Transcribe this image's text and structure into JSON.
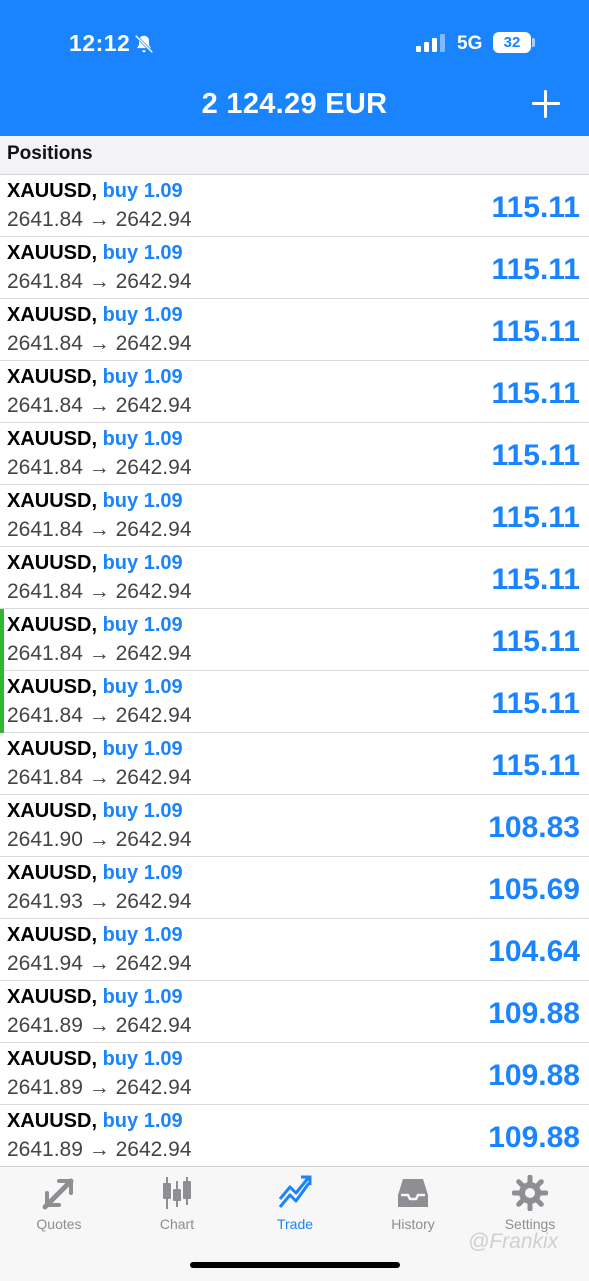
{
  "status_bar": {
    "time": "12:12",
    "network": "5G",
    "battery": "32"
  },
  "header": {
    "balance": "2 124.29 EUR"
  },
  "section": {
    "title": "Positions"
  },
  "positions": [
    {
      "symbol": "XAUUSD",
      "side": "buy 1.09",
      "open": "2641.84",
      "current": "2642.94",
      "profit": "115.11",
      "marked": false
    },
    {
      "symbol": "XAUUSD",
      "side": "buy 1.09",
      "open": "2641.84",
      "current": "2642.94",
      "profit": "115.11",
      "marked": false
    },
    {
      "symbol": "XAUUSD",
      "side": "buy 1.09",
      "open": "2641.84",
      "current": "2642.94",
      "profit": "115.11",
      "marked": false
    },
    {
      "symbol": "XAUUSD",
      "side": "buy 1.09",
      "open": "2641.84",
      "current": "2642.94",
      "profit": "115.11",
      "marked": false
    },
    {
      "symbol": "XAUUSD",
      "side": "buy 1.09",
      "open": "2641.84",
      "current": "2642.94",
      "profit": "115.11",
      "marked": false
    },
    {
      "symbol": "XAUUSD",
      "side": "buy 1.09",
      "open": "2641.84",
      "current": "2642.94",
      "profit": "115.11",
      "marked": false
    },
    {
      "symbol": "XAUUSD",
      "side": "buy 1.09",
      "open": "2641.84",
      "current": "2642.94",
      "profit": "115.11",
      "marked": false
    },
    {
      "symbol": "XAUUSD",
      "side": "buy 1.09",
      "open": "2641.84",
      "current": "2642.94",
      "profit": "115.11",
      "marked": true
    },
    {
      "symbol": "XAUUSD",
      "side": "buy 1.09",
      "open": "2641.84",
      "current": "2642.94",
      "profit": "115.11",
      "marked": true
    },
    {
      "symbol": "XAUUSD",
      "side": "buy 1.09",
      "open": "2641.84",
      "current": "2642.94",
      "profit": "115.11",
      "marked": false
    },
    {
      "symbol": "XAUUSD",
      "side": "buy 1.09",
      "open": "2641.90",
      "current": "2642.94",
      "profit": "108.83",
      "marked": false
    },
    {
      "symbol": "XAUUSD",
      "side": "buy 1.09",
      "open": "2641.93",
      "current": "2642.94",
      "profit": "105.69",
      "marked": false
    },
    {
      "symbol": "XAUUSD",
      "side": "buy 1.09",
      "open": "2641.94",
      "current": "2642.94",
      "profit": "104.64",
      "marked": false
    },
    {
      "symbol": "XAUUSD",
      "side": "buy 1.09",
      "open": "2641.89",
      "current": "2642.94",
      "profit": "109.88",
      "marked": false
    },
    {
      "symbol": "XAUUSD",
      "side": "buy 1.09",
      "open": "2641.89",
      "current": "2642.94",
      "profit": "109.88",
      "marked": false
    },
    {
      "symbol": "XAUUSD",
      "side": "buy 1.09",
      "open": "2641.89",
      "current": "2642.94",
      "profit": "109.88",
      "marked": false
    }
  ],
  "tabs": [
    {
      "label": "Quotes",
      "icon": "quotes-icon",
      "active": false
    },
    {
      "label": "Chart",
      "icon": "chart-icon",
      "active": false
    },
    {
      "label": "Trade",
      "icon": "trade-icon",
      "active": true
    },
    {
      "label": "History",
      "icon": "history-icon",
      "active": false
    },
    {
      "label": "Settings",
      "icon": "settings-icon",
      "active": false
    }
  ],
  "watermark": "@Frankix",
  "colors": {
    "accent": "#1a84ff",
    "marker": "#2eb82e",
    "tab_inactive": "#8e8e93"
  }
}
